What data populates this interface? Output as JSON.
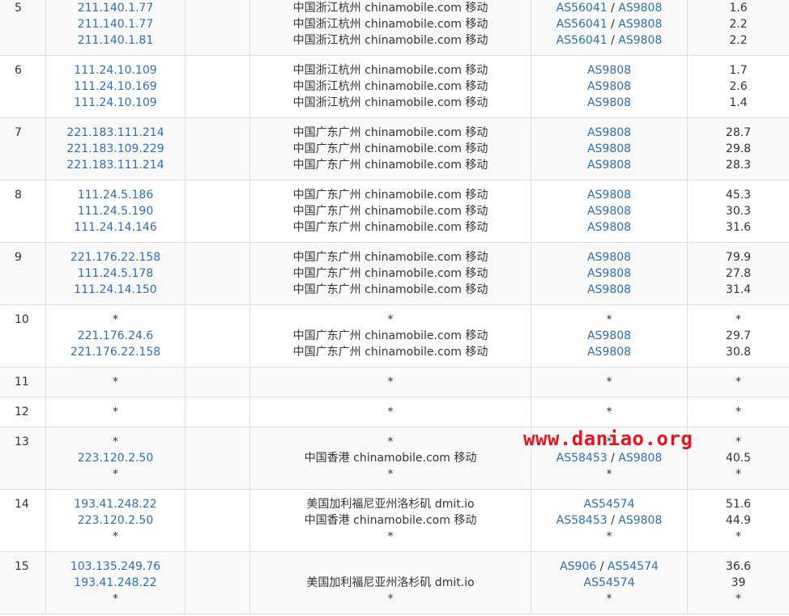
{
  "watermark": "www.daniao.org",
  "hops": [
    {
      "hop": "5",
      "ips": [
        "211.140.1.77",
        "211.140.1.77",
        "211.140.1.81"
      ],
      "locations": [
        "中国浙江杭州 chinamobile.com 移动",
        "中国浙江杭州 chinamobile.com 移动",
        "中国浙江杭州 chinamobile.com 移动"
      ],
      "as": [
        [
          "AS56041",
          "AS9808"
        ],
        [
          "AS56041",
          "AS9808"
        ],
        [
          "AS56041",
          "AS9808"
        ]
      ],
      "times": [
        "1.6",
        "2.2",
        "2.2"
      ]
    },
    {
      "hop": "6",
      "ips": [
        "111.24.10.109",
        "111.24.10.169",
        "111.24.10.109"
      ],
      "locations": [
        "中国浙江杭州 chinamobile.com 移动",
        "中国浙江杭州 chinamobile.com 移动",
        "中国浙江杭州 chinamobile.com 移动"
      ],
      "as": [
        [
          "AS9808"
        ],
        [
          "AS9808"
        ],
        [
          "AS9808"
        ]
      ],
      "times": [
        "1.7",
        "2.6",
        "1.4"
      ]
    },
    {
      "hop": "7",
      "ips": [
        "221.183.111.214",
        "221.183.109.229",
        "221.183.111.214"
      ],
      "locations": [
        "中国广东广州 chinamobile.com 移动",
        "中国广东广州 chinamobile.com 移动",
        "中国广东广州 chinamobile.com 移动"
      ],
      "as": [
        [
          "AS9808"
        ],
        [
          "AS9808"
        ],
        [
          "AS9808"
        ]
      ],
      "times": [
        "28.7",
        "29.8",
        "28.3"
      ]
    },
    {
      "hop": "8",
      "ips": [
        "111.24.5.186",
        "111.24.5.190",
        "111.24.14.146"
      ],
      "locations": [
        "中国广东广州 chinamobile.com 移动",
        "中国广东广州 chinamobile.com 移动",
        "中国广东广州 chinamobile.com 移动"
      ],
      "as": [
        [
          "AS9808"
        ],
        [
          "AS9808"
        ],
        [
          "AS9808"
        ]
      ],
      "times": [
        "45.3",
        "30.3",
        "31.6"
      ]
    },
    {
      "hop": "9",
      "ips": [
        "221.176.22.158",
        "111.24.5.178",
        "111.24.14.150"
      ],
      "locations": [
        "中国广东广州 chinamobile.com 移动",
        "中国广东广州 chinamobile.com 移动",
        "中国广东广州 chinamobile.com 移动"
      ],
      "as": [
        [
          "AS9808"
        ],
        [
          "AS9808"
        ],
        [
          "AS9808"
        ]
      ],
      "times": [
        "79.9",
        "27.8",
        "31.4"
      ]
    },
    {
      "hop": "10",
      "ips": [
        "*",
        "221.176.24.6",
        "221.176.22.158"
      ],
      "locations": [
        "*",
        "中国广东广州 chinamobile.com 移动",
        "中国广东广州 chinamobile.com 移动"
      ],
      "as": [
        [
          "*"
        ],
        [
          "AS9808"
        ],
        [
          "AS9808"
        ]
      ],
      "times": [
        "*",
        "29.7",
        "30.8"
      ]
    },
    {
      "hop": "11",
      "ips": [
        "*"
      ],
      "locations": [
        "*"
      ],
      "as": [
        [
          "*"
        ]
      ],
      "times": [
        "*"
      ]
    },
    {
      "hop": "12",
      "ips": [
        "*"
      ],
      "locations": [
        "*"
      ],
      "as": [
        [
          "*"
        ]
      ],
      "times": [
        "*"
      ]
    },
    {
      "hop": "13",
      "ips": [
        "*",
        "223.120.2.50",
        "*"
      ],
      "locations": [
        "*",
        "中国香港 chinamobile.com 移动",
        "*"
      ],
      "as": [
        [
          "*"
        ],
        [
          "AS58453",
          "AS9808"
        ],
        [
          "*"
        ]
      ],
      "times": [
        "*",
        "40.5",
        "*"
      ]
    },
    {
      "hop": "14",
      "ips": [
        "193.41.248.22",
        "223.120.2.50",
        "*"
      ],
      "locations": [
        "美国加利福尼亚州洛杉矶 dmit.io",
        "中国香港 chinamobile.com 移动",
        "*"
      ],
      "as": [
        [
          "AS54574"
        ],
        [
          "AS58453",
          "AS9808"
        ],
        [
          "*"
        ]
      ],
      "times": [
        "51.6",
        "44.9",
        "*"
      ]
    },
    {
      "hop": "15",
      "ips": [
        "103.135.249.76",
        "193.41.248.22",
        "*"
      ],
      "locations": [
        "",
        "美国加利福尼亚州洛杉矶 dmit.io",
        "*"
      ],
      "as": [
        [
          "AS906",
          "AS54574"
        ],
        [
          "AS54574"
        ],
        [
          "*"
        ]
      ],
      "times": [
        "36.6",
        "39",
        "*"
      ]
    }
  ]
}
